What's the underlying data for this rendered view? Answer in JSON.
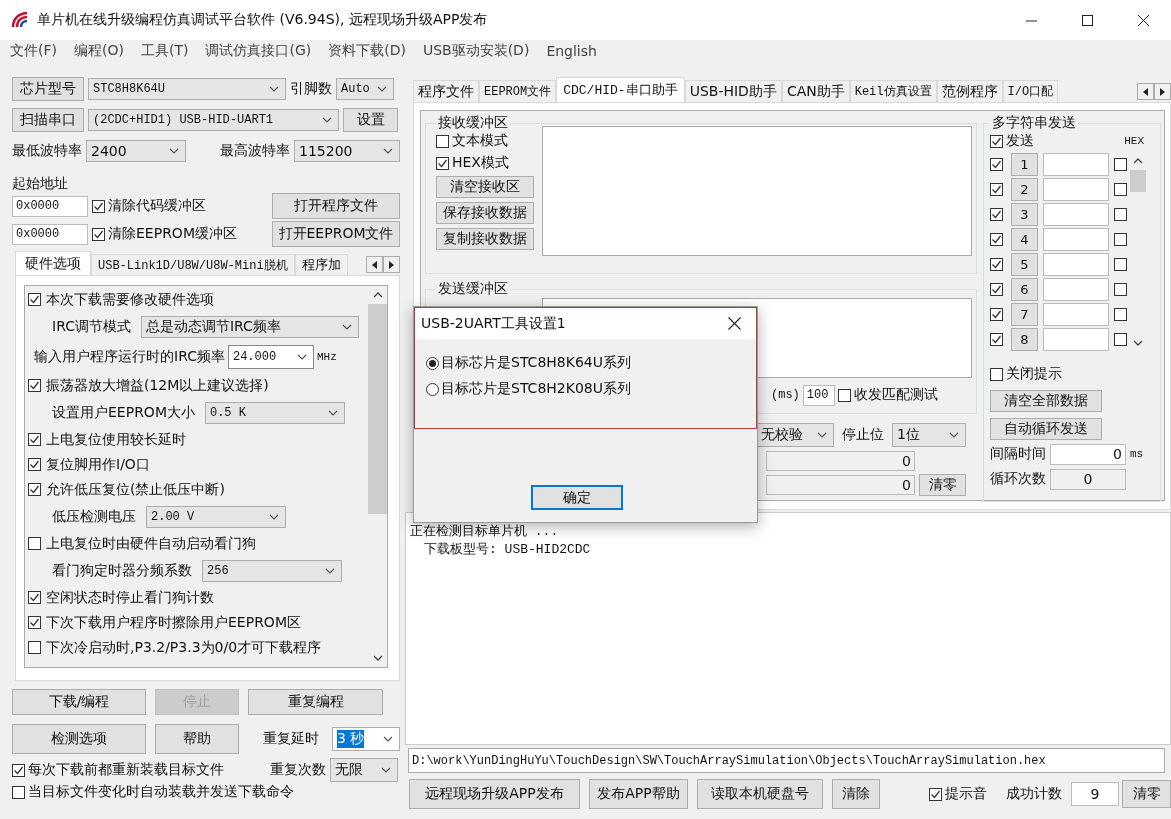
{
  "window": {
    "title": "单片机在线升级编程仿真调试平台软件 (V6.94S), 远程现场升级APP发布"
  },
  "menu": [
    "文件(F)",
    "编程(O)",
    "工具(T)",
    "调试仿真接口(G)",
    "资料下载(D)",
    "USB驱动安装(D)",
    "English"
  ],
  "chip": {
    "button": "芯片型号",
    "value": "STC8H8K64U",
    "pins_label": "引脚数",
    "pins_value": "Auto"
  },
  "port": {
    "button": "扫描串口",
    "value": "(2CDC+HID1) USB-HID-UART1",
    "settings_button": "设置"
  },
  "baud": {
    "min_label": "最低波特率",
    "min_value": "2400",
    "max_label": "最高波特率",
    "max_value": "115200"
  },
  "start_address": {
    "label": "起始地址",
    "rows": [
      {
        "address": "0x0000",
        "option": "清除代码缓冲区",
        "checked": true,
        "button": "打开程序文件"
      },
      {
        "address": "0x0000",
        "option": "清除EEPROM缓冲区",
        "checked": true,
        "button": "打开EEPROM文件"
      }
    ]
  },
  "left_tabs": [
    {
      "label": "硬件选项",
      "selected": true
    },
    {
      "label": "USB-Link1D/U8W/U8W-Mini脱机",
      "selected": false
    },
    {
      "label": "程序加",
      "selected": false
    }
  ],
  "hardware_options": [
    {
      "kind": "checkbox",
      "label": "本次下载需要修改硬件选项",
      "checked": true
    },
    {
      "kind": "select",
      "label": "IRC调节模式",
      "value": "总是动态调节IRC频率"
    },
    {
      "kind": "combo",
      "label": "输入用户程序运行时的IRC频率",
      "value": "24.000",
      "unit": "MHz"
    },
    {
      "kind": "checkbox",
      "label": "振荡器放大增益(12M以上建议选择)",
      "checked": true
    },
    {
      "kind": "select",
      "label": "设置用户EEPROM大小",
      "value": "0.5 K"
    },
    {
      "kind": "checkbox",
      "label": "上电复位使用较长延时",
      "checked": true
    },
    {
      "kind": "checkbox",
      "label": "复位脚用作I/O口",
      "checked": true
    },
    {
      "kind": "checkbox",
      "label": "允许低压复位(禁止低压中断)",
      "checked": true
    },
    {
      "kind": "select",
      "label": "低压检测电压",
      "value": "2.00 V"
    },
    {
      "kind": "checkbox",
      "label": "上电复位时由硬件自动启动看门狗",
      "checked": false
    },
    {
      "kind": "select",
      "label": "看门狗定时器分频系数",
      "value": "256"
    },
    {
      "kind": "checkbox",
      "label": "空闲状态时停止看门狗计数",
      "checked": true
    },
    {
      "kind": "checkbox",
      "label": "下次下载用户程序时擦除用户EEPROM区",
      "checked": true
    },
    {
      "kind": "checkbox",
      "label": "下次冷启动时,P3.2/P3.3为0/0才可下载程序",
      "checked": false
    }
  ],
  "actions": {
    "buttons": [
      {
        "label": "下载/编程",
        "disabled": false
      },
      {
        "label": "停止",
        "disabled": true
      },
      {
        "label": "重复编程",
        "disabled": false
      },
      {
        "label": "检测选项",
        "disabled": false
      },
      {
        "label": "帮助",
        "disabled": false
      }
    ],
    "repeat_delay_label": "重复延时",
    "repeat_delay_value": "3 秒",
    "repeat_delay_focused": true,
    "repeat_count_label": "重复次数",
    "repeat_count_value": "无限"
  },
  "reload_options": [
    {
      "label": "每次下载前都重新装载目标文件",
      "checked": true
    },
    {
      "label": "当目标文件变化时自动装载并发送下载命令",
      "checked": false
    }
  ],
  "right_tabs": [
    {
      "label": "程序文件",
      "selected": false
    },
    {
      "label": "EEPROM文件",
      "selected": false
    },
    {
      "label": "CDC/HID-串口助手",
      "selected": true
    },
    {
      "label": "USB-HID助手",
      "selected": false
    },
    {
      "label": "CAN助手",
      "selected": false
    },
    {
      "label": "Keil仿真设置",
      "selected": false
    },
    {
      "label": "范例程序",
      "selected": false
    },
    {
      "label": "I/O口配",
      "selected": false
    }
  ],
  "receive": {
    "title": "接收缓冲区",
    "modes": [
      {
        "label": "文本模式",
        "checked": false
      },
      {
        "label": "HEX模式",
        "checked": true
      }
    ],
    "buttons": [
      "清空接收区",
      "保存接收数据",
      "复制接收数据"
    ]
  },
  "send": {
    "title": "发送缓冲区",
    "period_unit": "(ms)",
    "period_value": "100",
    "match_test": {
      "label": "收发匹配测试",
      "checked": false
    },
    "parity_value": "无校验",
    "stop_label": "停止位",
    "stop_value": "1位",
    "sent_count": "0",
    "received_count": "0",
    "clear_button": "清零"
  },
  "multi_send": {
    "title": "多字符串发送",
    "send_all": {
      "label": "发送",
      "checked": true
    },
    "hex_label": "HEX",
    "rows": [
      {
        "number": "1",
        "checked": true,
        "hex": false
      },
      {
        "number": "2",
        "checked": true,
        "hex": false
      },
      {
        "number": "3",
        "checked": true,
        "hex": false
      },
      {
        "number": "4",
        "checked": true,
        "hex": false
      },
      {
        "number": "5",
        "checked": true,
        "hex": false
      },
      {
        "number": "6",
        "checked": true,
        "hex": false
      },
      {
        "number": "7",
        "checked": true,
        "hex": false
      },
      {
        "number": "8",
        "checked": true,
        "hex": false
      }
    ],
    "close_tip": {
      "label": "关闭提示",
      "checked": false
    },
    "buttons": [
      "清空全部数据",
      "自动循环发送"
    ],
    "interval_label": "间隔时间",
    "interval_value": "0",
    "interval_unit": "ms",
    "loop_label": "循环次数",
    "loop_value": "0"
  },
  "log": [
    {
      "text": "正在检测目标单片机 ...",
      "indent": false
    },
    {
      "text": "下载板型号: USB-HID2CDC",
      "indent": true
    }
  ],
  "file_path": "D:\\work\\YunDingHuYu\\TouchDesign\\SW\\TouchArraySimulation\\Objects\\TouchArraySimulation.hex",
  "bottom": {
    "buttons": [
      "远程现场升级APP发布",
      "发布APP帮助",
      "读取本机硬盘号",
      "清除"
    ],
    "beep": {
      "label": "提示音",
      "checked": true
    },
    "success_label": "成功计数",
    "success_value": "9",
    "clear_button": "清零"
  },
  "dialog": {
    "title": "USB-2UART工具设置1",
    "options": [
      {
        "label": "目标芯片是STC8H8K64U系列",
        "selected": true
      },
      {
        "label": "目标芯片是STC8H2K08U系列",
        "selected": false
      }
    ],
    "ok_button": "确定"
  }
}
